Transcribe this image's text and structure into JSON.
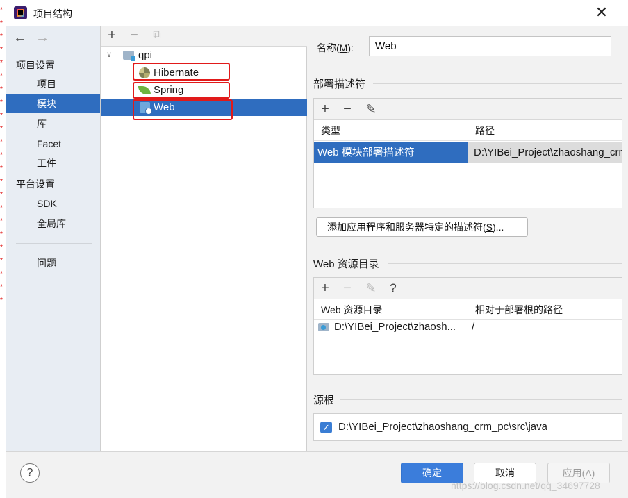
{
  "window": {
    "title": "项目结构"
  },
  "nav": {
    "back_glyph": "←",
    "forward_glyph": "→",
    "project_settings": "项目设置",
    "items_project": [
      "项目",
      "模块",
      "库",
      "Facet",
      "工件"
    ],
    "platform_settings": "平台设置",
    "items_platform": [
      "SDK",
      "全局库"
    ],
    "problems": "问题",
    "selected": "模块"
  },
  "tree": {
    "toolbar": {
      "add": "+",
      "remove": "−",
      "copy": "⧉"
    },
    "root": "qpi",
    "children": [
      "Hibernate",
      "Spring",
      "Web"
    ],
    "selected": "Web"
  },
  "main": {
    "name_label": "名称(",
    "name_mnemonic": "M",
    "name_label_end": "):",
    "name_value": "Web",
    "deploy_section": "部署描述符",
    "deploy_toolbar": {
      "add": "+",
      "remove": "−",
      "edit": "✎"
    },
    "deploy_columns": [
      "类型",
      "路径"
    ],
    "deploy_rows": [
      {
        "type": "Web 模块部署描述符",
        "path": "D:\\YIBei_Project\\zhaoshang_crm_pc\\web\\WEB-INF\\web.xml"
      }
    ],
    "add_descriptor_button": "添加应用程序和服务器特定的描述符(",
    "add_descriptor_mnemonic": "S",
    "add_descriptor_end": ")...",
    "resource_section": "Web 资源目录",
    "resource_toolbar": {
      "add": "+",
      "remove": "−",
      "edit": "✎",
      "help": "?"
    },
    "resource_columns": [
      "Web 资源目录",
      "相对于部署根的路径"
    ],
    "resource_rows": [
      {
        "dir": "D:\\YIBei_Project\\zhaosh...",
        "rel": "/"
      }
    ],
    "source_section": "源根",
    "source_roots": [
      {
        "checked": true,
        "path": "D:\\YIBei_Project\\zhaoshang_crm_pc\\src\\java"
      }
    ]
  },
  "footer": {
    "help": "?",
    "ok": "确定",
    "cancel": "取消",
    "apply": "应用(A)"
  },
  "watermark": "https://blog.csdn.net/qq_34697728",
  "colors": {
    "accent": "#2f6dbf",
    "primary_button": "#3b7ddb",
    "annotation": "#e11a1a"
  },
  "icons": {
    "app": "intellij-icon",
    "close": "close-icon",
    "module_root": "module-folder-icon",
    "hibernate": "hibernate-icon",
    "spring": "spring-leaf-icon",
    "web": "web-facet-icon",
    "checkbox": "checkbox-checked-icon"
  }
}
